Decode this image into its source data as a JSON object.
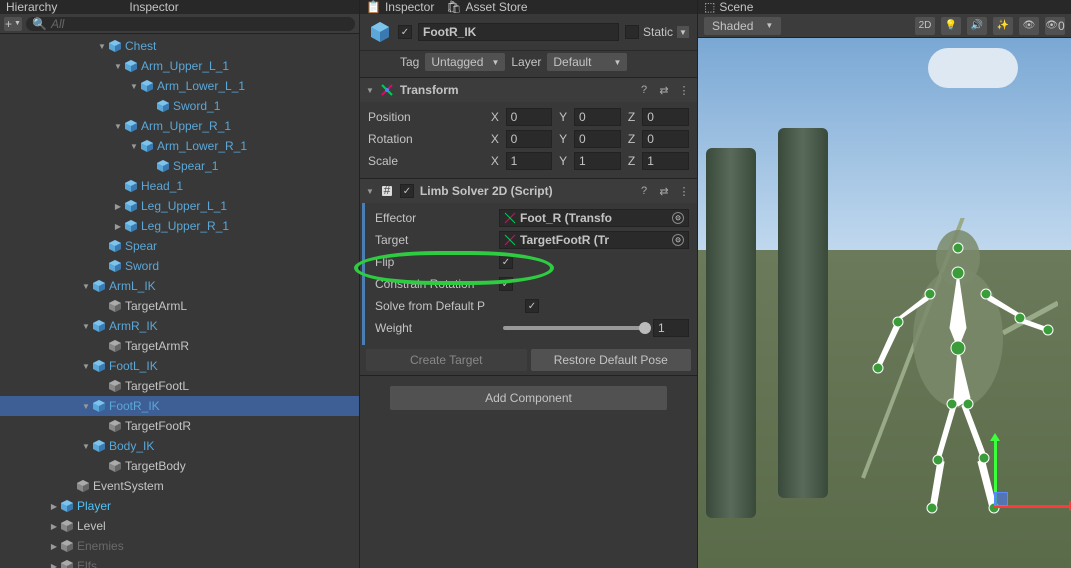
{
  "tabs": {
    "hierarchy": "Hierarchy",
    "inspector_top": "Inspector",
    "asset_store": "Asset Store",
    "inspector_right": "Inspector",
    "scene": "Scene"
  },
  "hierarchy": {
    "plus": "+",
    "search_placeholder": "All",
    "items": [
      {
        "indent": 6,
        "fold": "▼",
        "blue": true,
        "label": "Chest"
      },
      {
        "indent": 7,
        "fold": "▼",
        "blue": true,
        "label": "Arm_Upper_L_1"
      },
      {
        "indent": 8,
        "fold": "▼",
        "blue": true,
        "label": "Arm_Lower_L_1"
      },
      {
        "indent": 9,
        "fold": "",
        "blue": true,
        "label": "Sword_1"
      },
      {
        "indent": 7,
        "fold": "▼",
        "blue": true,
        "label": "Arm_Upper_R_1"
      },
      {
        "indent": 8,
        "fold": "▼",
        "blue": true,
        "label": "Arm_Lower_R_1"
      },
      {
        "indent": 9,
        "fold": "",
        "blue": true,
        "label": "Spear_1"
      },
      {
        "indent": 7,
        "fold": "",
        "blue": true,
        "label": "Head_1"
      },
      {
        "indent": 7,
        "fold": "▶",
        "blue": true,
        "label": "Leg_Upper_L_1"
      },
      {
        "indent": 7,
        "fold": "▶",
        "blue": true,
        "label": "Leg_Upper_R_1"
      },
      {
        "indent": 6,
        "fold": "",
        "blue": true,
        "label": "Spear"
      },
      {
        "indent": 6,
        "fold": "",
        "blue": true,
        "label": "Sword"
      },
      {
        "indent": 5,
        "fold": "▼",
        "blue": true,
        "label": "ArmL_IK"
      },
      {
        "indent": 6,
        "fold": "",
        "blue": false,
        "label": "TargetArmL"
      },
      {
        "indent": 5,
        "fold": "▼",
        "blue": true,
        "label": "ArmR_IK"
      },
      {
        "indent": 6,
        "fold": "",
        "blue": false,
        "label": "TargetArmR"
      },
      {
        "indent": 5,
        "fold": "▼",
        "blue": true,
        "label": "FootL_IK"
      },
      {
        "indent": 6,
        "fold": "",
        "blue": false,
        "label": "TargetFootL"
      },
      {
        "indent": 5,
        "fold": "▼",
        "blue": true,
        "label": "FootR_IK",
        "selected": true
      },
      {
        "indent": 6,
        "fold": "",
        "blue": false,
        "label": "TargetFootR"
      },
      {
        "indent": 5,
        "fold": "▼",
        "blue": true,
        "label": "Body_IK"
      },
      {
        "indent": 6,
        "fold": "",
        "blue": false,
        "label": "TargetBody"
      },
      {
        "indent": 4,
        "fold": "",
        "blue": false,
        "label": "EventSystem"
      },
      {
        "indent": 3,
        "fold": "▶",
        "blue": true,
        "faded": false,
        "label": "Player",
        "cyan": true
      },
      {
        "indent": 3,
        "fold": "▶",
        "blue": false,
        "label": "Level"
      },
      {
        "indent": 3,
        "fold": "▶",
        "blue": false,
        "faded": true,
        "label": "Enemies"
      },
      {
        "indent": 3,
        "fold": "▶",
        "blue": false,
        "faded": true,
        "label": "Elfs"
      }
    ]
  },
  "inspector": {
    "enabled": true,
    "name": "FootR_IK",
    "static_label": "Static",
    "tag_label": "Tag",
    "tag_value": "Untagged",
    "layer_label": "Layer",
    "layer_value": "Default",
    "transform": {
      "title": "Transform",
      "position_label": "Position",
      "rotation_label": "Rotation",
      "scale_label": "Scale",
      "x": "X",
      "y": "Y",
      "z": "Z",
      "pos": {
        "x": "0",
        "y": "0",
        "z": "0"
      },
      "rot": {
        "x": "0",
        "y": "0",
        "z": "0"
      },
      "scl": {
        "x": "1",
        "y": "1",
        "z": "1"
      }
    },
    "limb": {
      "title": "Limb Solver 2D (Script)",
      "effector_label": "Effector",
      "effector_value": "Foot_R (Transfo",
      "target_label": "Target",
      "target_value": "TargetFootR (Tr",
      "flip_label": "Flip",
      "flip_checked": true,
      "constrain_label": "Constrain Rotation",
      "constrain_checked": true,
      "solve_label": "Solve from Default P",
      "solve_checked": true,
      "weight_label": "Weight",
      "weight_value": "1",
      "create_target": "Create Target",
      "restore": "Restore Default Pose"
    },
    "add_component": "Add Component"
  },
  "scene": {
    "shading": "Shaded",
    "btn_2d": "2D",
    "icons": {
      "light": "💡",
      "sound": "🔊",
      "fx": "✨",
      "vis": "👁",
      "hidden": "0"
    }
  },
  "icons": {
    "cube_svg": "cube",
    "help": "?",
    "preset": "⇄",
    "menu": "⋮"
  }
}
